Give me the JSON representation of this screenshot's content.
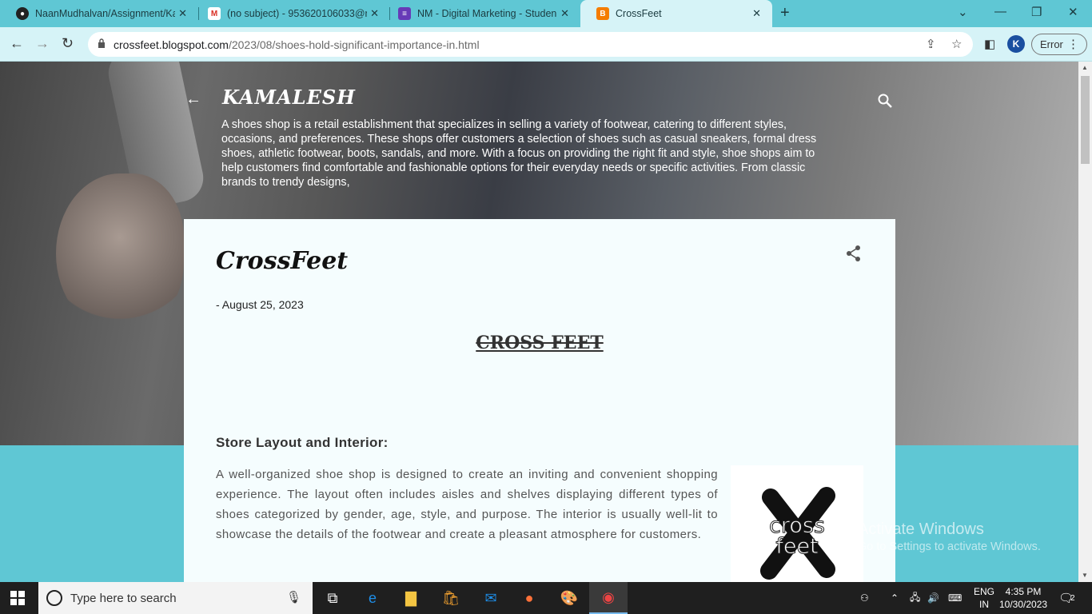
{
  "browser": {
    "tabs": [
      {
        "title": "NaanMudhalvan/Assignment/Ka",
        "favicon": "github-icon"
      },
      {
        "title": "(no subject) - 953620106033@n",
        "favicon": "gmail-icon"
      },
      {
        "title": "NM - Digital Marketing - Studen",
        "favicon": "forms-icon"
      },
      {
        "title": "CrossFeet",
        "favicon": "blogger-icon"
      }
    ],
    "url_host": "crossfeet.blogspot.com",
    "url_path": "/2023/08/shoes-hold-significant-importance-in.html",
    "profile_initial": "K",
    "error_label": "Error"
  },
  "blog": {
    "title": "KAMALESH",
    "description": "A shoes shop is a retail establishment that specializes in selling a variety of footwear, catering to different styles, occasions, and preferences. These shops offer customers a selection of shoes such as casual sneakers, formal dress shoes, athletic footwear, boots, sandals, and more. With a focus on providing the right fit and style, shoe shops aim to help customers find comfortable and fashionable options for their everyday needs or specific activities. From classic brands to trendy designs,"
  },
  "post": {
    "title": "CrossFeet",
    "date": "- August 25, 2023",
    "center_heading": "CROSS FEET",
    "section_heading": "Store Layout and Interior:",
    "paragraph": "A well-organized shoe shop is designed to create an inviting and convenient shopping experience. The layout often includes aisles and shelves displaying different types of shoes categorized by gender, age, style, and purpose. The interior is usually well-lit to showcase the details of the footwear and create a pleasant atmosphere for customers.",
    "logo_text_1": "cross",
    "logo_text_2": "feet"
  },
  "watermark": {
    "line1": "Activate Windows",
    "line2": "Go to Settings to activate Windows."
  },
  "taskbar": {
    "search_placeholder": "Type here to search",
    "lang_line1": "ENG",
    "lang_line2": "IN",
    "time": "4:35 PM",
    "date": "10/30/2023",
    "notification_count": "2"
  },
  "colors": {
    "accent": "#5fc7d4",
    "post_bg": "#f5fdfe"
  }
}
